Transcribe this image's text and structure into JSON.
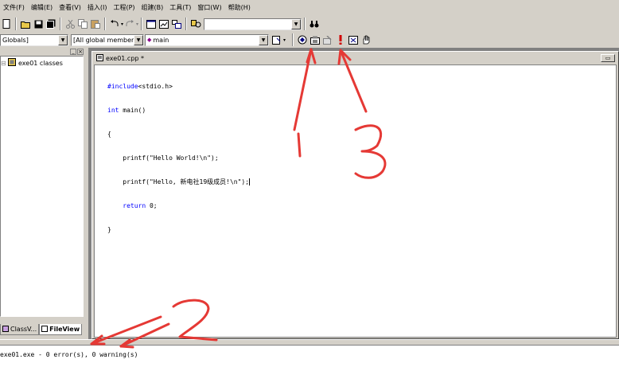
{
  "menu": [
    "文件(F)",
    "编辑(E)",
    "查看(V)",
    "插入(I)",
    "工程(P)",
    "组建(B)",
    "工具(T)",
    "窗口(W)",
    "帮助(H)"
  ],
  "toolbar2": {
    "class_combo": "Globals]",
    "members_combo": "[All global members",
    "function_combo": "main"
  },
  "left_pane": {
    "tree_root": "exe01 classes",
    "tabs": [
      "ClassV...",
      "FileView"
    ]
  },
  "editor": {
    "title": "exe01.cpp *",
    "code_lines": [
      {
        "kw": "#include",
        "rest": "<stdio.h>"
      },
      {
        "kw": "int",
        "rest": " main()"
      },
      {
        "kw": "",
        "rest": "{"
      },
      {
        "kw": "",
        "rest": "    printf(\"Hello World!\\n\");"
      },
      {
        "kw": "",
        "rest": "    printf(\"Hello, 新电社19级成员!\\n\");"
      },
      {
        "kw": "    return",
        "rest": " 0;"
      },
      {
        "kw": "",
        "rest": "}"
      }
    ]
  },
  "output": {
    "line": "exe01.exe - 0 error(s), 0 warning(s)"
  },
  "annotations": [
    "1",
    "2",
    "3"
  ],
  "colors": {
    "annotation": "#e53935",
    "keyword": "#0000ff",
    "background": "#d4d0c8"
  }
}
